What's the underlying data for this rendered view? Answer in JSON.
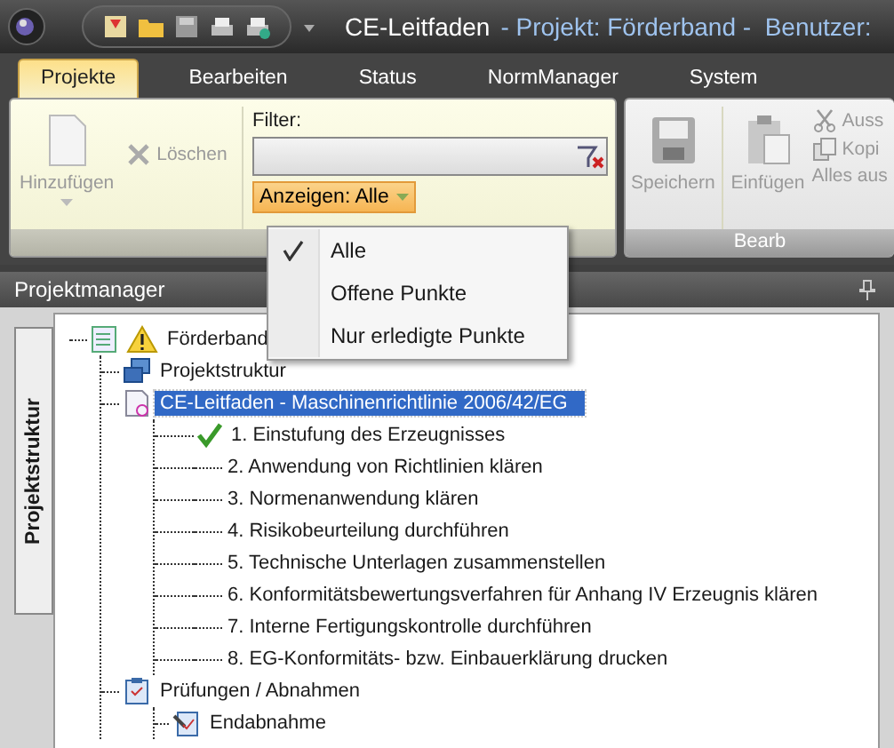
{
  "title_bar": {
    "title": "CE-Leitfaden",
    "context": "- Projekt: Förderband -  Benutzer:"
  },
  "ribbon_tabs": [
    {
      "label": "Projekte",
      "selected": true
    },
    {
      "label": "Bearbeiten",
      "selected": false
    },
    {
      "label": "Status",
      "selected": false
    },
    {
      "label": "NormManager",
      "selected": false
    },
    {
      "label": "System",
      "selected": false
    }
  ],
  "ribbon": {
    "add_button": {
      "label": "Hinzufügen",
      "disabled": true
    },
    "delete_button": {
      "label": "Löschen",
      "disabled": true
    },
    "filter": {
      "label": "Filter:"
    },
    "show_dropdown": {
      "label": "Anzeigen: Alle",
      "expanded": true
    },
    "edit_group": {
      "label": "Bearb",
      "save_button": {
        "label": "Speichern",
        "disabled": true
      },
      "paste_button": {
        "label": "Einfügen",
        "disabled": true
      },
      "cut_button": {
        "label": "Auss",
        "disabled": true
      },
      "copy_button": {
        "label": "Kopi",
        "disabled": true
      },
      "select_all_button": {
        "label": "Alles aus",
        "disabled": true
      }
    }
  },
  "dropdown_menu": {
    "items": [
      {
        "label": "Alle",
        "selected": true
      },
      {
        "label": "Offene Punkte",
        "selected": false
      },
      {
        "label": "Nur erledigte Punkte",
        "selected": false
      }
    ]
  },
  "panel": {
    "title": "Projektmanager",
    "side_tab": "Projektstruktur"
  },
  "tree": [
    {
      "label": "Förderband",
      "kind": "project",
      "warning": true,
      "selected": false,
      "children": [
        {
          "label": "Projektstruktur",
          "kind": "structure",
          "selected": false
        },
        {
          "label": "CE-Leitfaden - Maschinenrichtlinie 2006/42/EG",
          "kind": "guide",
          "selected": true,
          "children": [
            {
              "label": "1. Einstufung des Erzeugnisses",
              "kind": "step",
              "done": true,
              "selected": false
            },
            {
              "label": "2. Anwendung von Richtlinien klären",
              "kind": "step",
              "done": false,
              "selected": false
            },
            {
              "label": "3. Normenanwendung klären",
              "kind": "step",
              "done": false,
              "selected": false
            },
            {
              "label": "4. Risikobeurteilung durchführen",
              "kind": "step",
              "done": false,
              "selected": false
            },
            {
              "label": "5. Technische Unterlagen zusammenstellen",
              "kind": "step",
              "done": false,
              "selected": false
            },
            {
              "label": "6. Konformitätsbewertungsverfahren für Anhang IV Erzeugnis klären",
              "kind": "step",
              "done": false,
              "selected": false
            },
            {
              "label": "7. Interne Fertigungskontrolle durchführen",
              "kind": "step",
              "done": false,
              "selected": false
            },
            {
              "label": "8. EG-Konformitäts- bzw. Einbauerklärung drucken",
              "kind": "step",
              "done": false,
              "selected": false
            }
          ]
        },
        {
          "label": "Prüfungen / Abnahmen",
          "kind": "tests",
          "selected": false,
          "children": [
            {
              "label": "Endabnahme",
              "kind": "test",
              "selected": false
            }
          ]
        }
      ]
    }
  ]
}
